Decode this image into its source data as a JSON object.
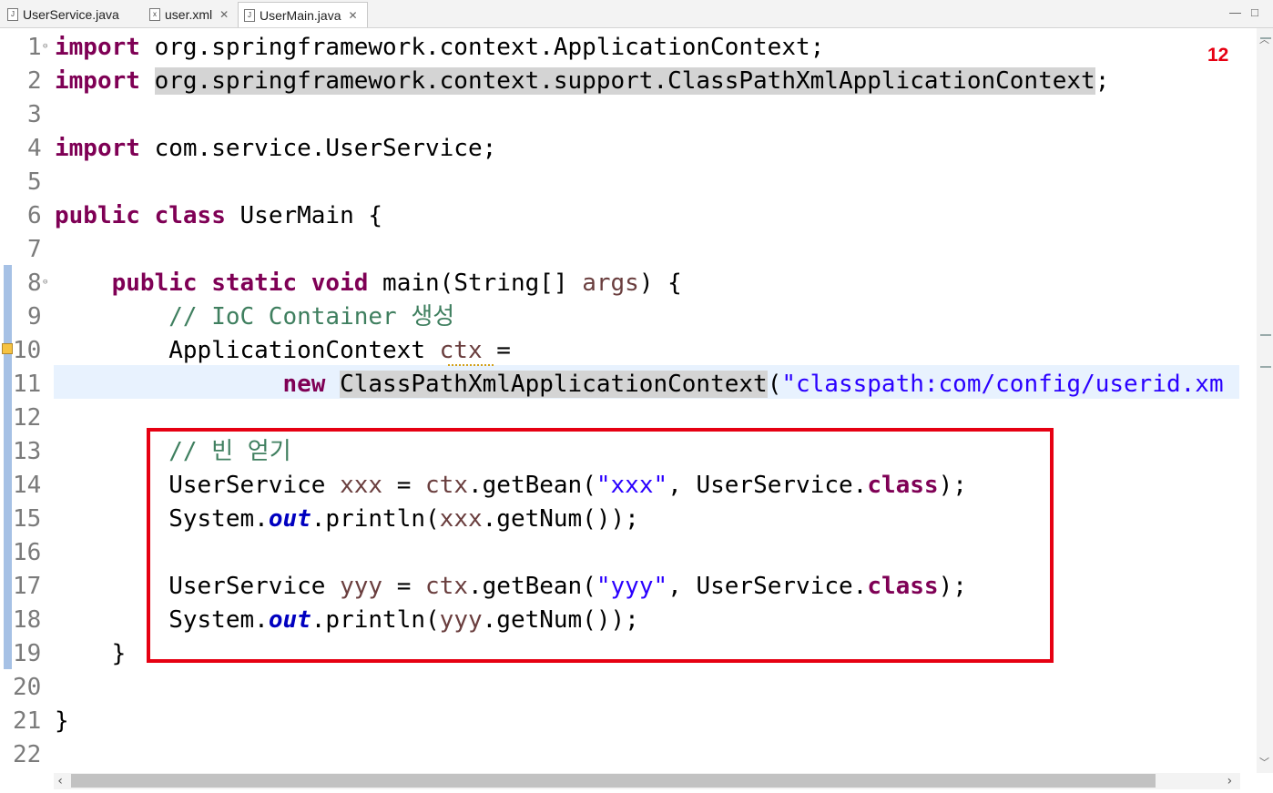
{
  "tabs": [
    {
      "label": "UserService.java",
      "closable": false,
      "active": false,
      "icon": "java-file-icon"
    },
    {
      "label": "user.xml",
      "closable": true,
      "active": false,
      "icon": "xml-file-icon"
    },
    {
      "label": "UserMain.java",
      "closable": true,
      "active": true,
      "icon": "java-file-icon"
    }
  ],
  "window_controls": {
    "minimize": "—",
    "maximize": "□"
  },
  "annotation": {
    "count": "12"
  },
  "lines": [
    {
      "n": "1",
      "segments": [
        {
          "t": "import",
          "c": "kw"
        },
        {
          "t": " org.springframework.context.ApplicationContext;",
          "c": ""
        }
      ]
    },
    {
      "n": "2",
      "segments": [
        {
          "t": "import",
          "c": "kw"
        },
        {
          "t": " ",
          "c": ""
        },
        {
          "t": "org.springframework.context.support.ClassPathXmlApplicationContext",
          "c": "occ"
        },
        {
          "t": ";",
          "c": ""
        }
      ]
    },
    {
      "n": "3",
      "segments": []
    },
    {
      "n": "4",
      "segments": [
        {
          "t": "import",
          "c": "kw"
        },
        {
          "t": " com.service.UserService;",
          "c": ""
        }
      ]
    },
    {
      "n": "5",
      "segments": []
    },
    {
      "n": "6",
      "segments": [
        {
          "t": "public",
          "c": "kw"
        },
        {
          "t": " ",
          "c": ""
        },
        {
          "t": "class",
          "c": "kw"
        },
        {
          "t": " UserMain {",
          "c": ""
        }
      ]
    },
    {
      "n": "7",
      "segments": []
    },
    {
      "n": "8",
      "segments": [
        {
          "t": "    ",
          "c": ""
        },
        {
          "t": "public",
          "c": "kw"
        },
        {
          "t": " ",
          "c": ""
        },
        {
          "t": "static",
          "c": "kw"
        },
        {
          "t": " ",
          "c": ""
        },
        {
          "t": "void",
          "c": "kw"
        },
        {
          "t": " main(String[] ",
          "c": ""
        },
        {
          "t": "args",
          "c": "var"
        },
        {
          "t": ") {",
          "c": ""
        }
      ]
    },
    {
      "n": "9",
      "segments": [
        {
          "t": "        ",
          "c": ""
        },
        {
          "t": "// IoC Container 생성",
          "c": "cmt"
        }
      ]
    },
    {
      "n": "10",
      "segments": [
        {
          "t": "        ApplicationContext ",
          "c": ""
        },
        {
          "t": "ctx",
          "c": "var"
        },
        {
          "t": " =",
          "c": ""
        }
      ]
    },
    {
      "n": "11",
      "segments": [
        {
          "t": "                ",
          "c": ""
        },
        {
          "t": "new",
          "c": "kw"
        },
        {
          "t": " ",
          "c": ""
        },
        {
          "t": "ClassPathXmlApplicationContext",
          "c": "occ"
        },
        {
          "t": "(",
          "c": ""
        },
        {
          "t": "\"classpath:com/config/userid.xm",
          "c": "str"
        }
      ]
    },
    {
      "n": "12",
      "segments": []
    },
    {
      "n": "13",
      "segments": [
        {
          "t": "        ",
          "c": ""
        },
        {
          "t": "// 빈 얻기",
          "c": "cmt"
        }
      ]
    },
    {
      "n": "14",
      "segments": [
        {
          "t": "        UserService ",
          "c": ""
        },
        {
          "t": "xxx",
          "c": "var"
        },
        {
          "t": " = ",
          "c": ""
        },
        {
          "t": "ctx",
          "c": "var"
        },
        {
          "t": ".getBean(",
          "c": ""
        },
        {
          "t": "\"xxx\"",
          "c": "str"
        },
        {
          "t": ", UserService.",
          "c": ""
        },
        {
          "t": "class",
          "c": "kw"
        },
        {
          "t": ");",
          "c": ""
        }
      ]
    },
    {
      "n": "15",
      "segments": [
        {
          "t": "        System.",
          "c": ""
        },
        {
          "t": "out",
          "c": "fld"
        },
        {
          "t": ".println(",
          "c": ""
        },
        {
          "t": "xxx",
          "c": "var"
        },
        {
          "t": ".getNum());",
          "c": ""
        }
      ]
    },
    {
      "n": "16",
      "segments": []
    },
    {
      "n": "17",
      "segments": [
        {
          "t": "        UserService ",
          "c": ""
        },
        {
          "t": "yyy",
          "c": "var"
        },
        {
          "t": " = ",
          "c": ""
        },
        {
          "t": "ctx",
          "c": "var"
        },
        {
          "t": ".getBean(",
          "c": ""
        },
        {
          "t": "\"yyy\"",
          "c": "str"
        },
        {
          "t": ", UserService.",
          "c": ""
        },
        {
          "t": "class",
          "c": "kw"
        },
        {
          "t": ");",
          "c": ""
        }
      ]
    },
    {
      "n": "18",
      "segments": [
        {
          "t": "        System.",
          "c": ""
        },
        {
          "t": "out",
          "c": "fld"
        },
        {
          "t": ".println(",
          "c": ""
        },
        {
          "t": "yyy",
          "c": "var"
        },
        {
          "t": ".getNum());",
          "c": ""
        }
      ]
    },
    {
      "n": "19",
      "segments": [
        {
          "t": "    }",
          "c": ""
        }
      ]
    },
    {
      "n": "20",
      "segments": []
    },
    {
      "n": "21",
      "segments": [
        {
          "t": "}",
          "c": ""
        }
      ]
    },
    {
      "n": "22",
      "segments": []
    }
  ],
  "colors": {
    "keyword": "#7f0055",
    "comment": "#3f7f5f",
    "string": "#2a00ff",
    "annotation_red": "#e60012",
    "current_line": "#e8f2fe"
  }
}
